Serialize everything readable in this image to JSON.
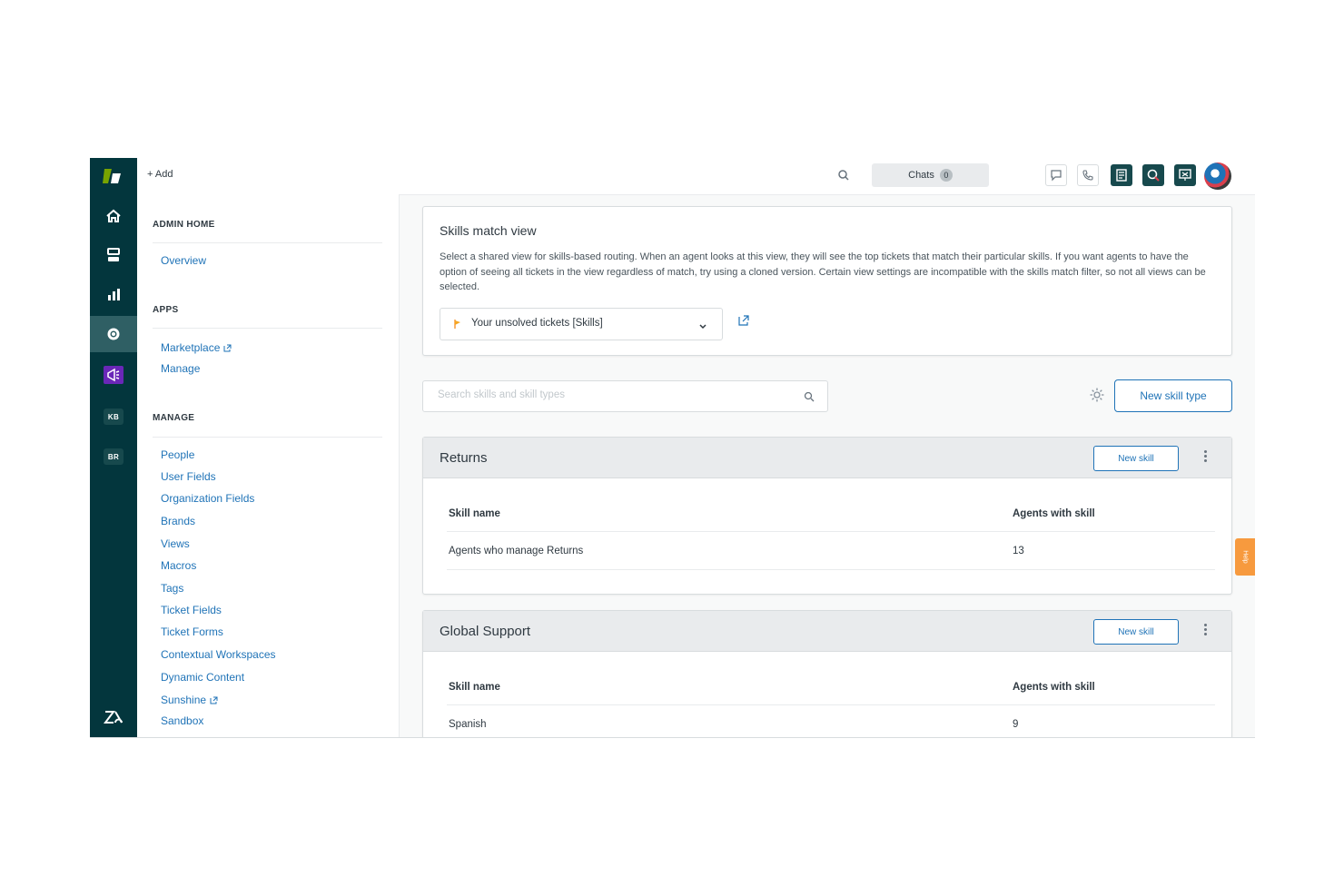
{
  "topbar": {
    "add_label": "+ Add",
    "chats_label": "Chats",
    "chats_count": "0"
  },
  "subnav": {
    "admin_home_heading": "ADMIN HOME",
    "overview": "Overview",
    "apps_heading": "APPS",
    "marketplace": "Marketplace",
    "manage": "Manage",
    "manage_heading": "MANAGE",
    "links": [
      "People",
      "User Fields",
      "Organization Fields",
      "Brands",
      "Views",
      "Macros",
      "Tags",
      "Ticket Fields",
      "Ticket Forms",
      "Contextual Workspaces",
      "Dynamic Content",
      "Sunshine",
      "Sandbox"
    ]
  },
  "rail": {
    "kb_label": "KB",
    "br_label": "BR"
  },
  "skills_match_view": {
    "title": "Skills match view",
    "description": "Select a shared view for skills-based routing. When an agent looks at this view, they will see the top tickets that match their particular skills. If you want agents to have the option of seeing all tickets in the view regardless of match, try using a cloned version. Certain view settings are incompatible with the skills match filter, so not all views can be selected.",
    "selected_view": "Your unsolved tickets [Skills]"
  },
  "search": {
    "placeholder": "Search skills and skill types"
  },
  "new_skill_type_label": "New skill type",
  "groups": [
    {
      "title": "Returns",
      "new_skill_label": "New skill",
      "col_skill": "Skill name",
      "col_agents": "Agents with skill",
      "rows": [
        {
          "name": "Agents who manage Returns",
          "agents": "13"
        }
      ]
    },
    {
      "title": "Global Support",
      "new_skill_label": "New skill",
      "col_skill": "Skill name",
      "col_agents": "Agents with skill",
      "rows": [
        {
          "name": "Spanish",
          "agents": "9"
        }
      ]
    }
  ],
  "help_label": "Help",
  "colors": {
    "rail_bg": "#03363d",
    "link_blue": "#1f73b7",
    "help_orange": "#f79a3e",
    "accent_green": "#78a300",
    "purple": "#6a27b8"
  },
  "icons": [
    "zendesk-logo-icon",
    "home-icon",
    "tickets-icon",
    "reporting-icon",
    "settings-icon",
    "guide-icon",
    "search-icon",
    "chat-bubble-icon",
    "phone-icon",
    "apps-grid-icon",
    "external-link-icon",
    "chevron-down-icon",
    "gear-icon",
    "kebab-icon",
    "flag-icon"
  ]
}
